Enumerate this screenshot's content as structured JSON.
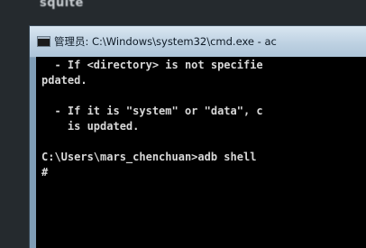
{
  "background_window": {
    "title_fragment": "squite"
  },
  "cmd_window": {
    "title": "管理员: C:\\Windows\\system32\\cmd.exe - ac",
    "icon": "console-window-icon"
  },
  "console": {
    "lines": [
      "  - If <directory> is not specifie",
      "pdated.",
      "",
      "  - If it is \"system\" or \"data\", c",
      "    is updated.",
      "",
      "C:\\Users\\mars_chenchuan>adb shell",
      "#"
    ]
  }
}
